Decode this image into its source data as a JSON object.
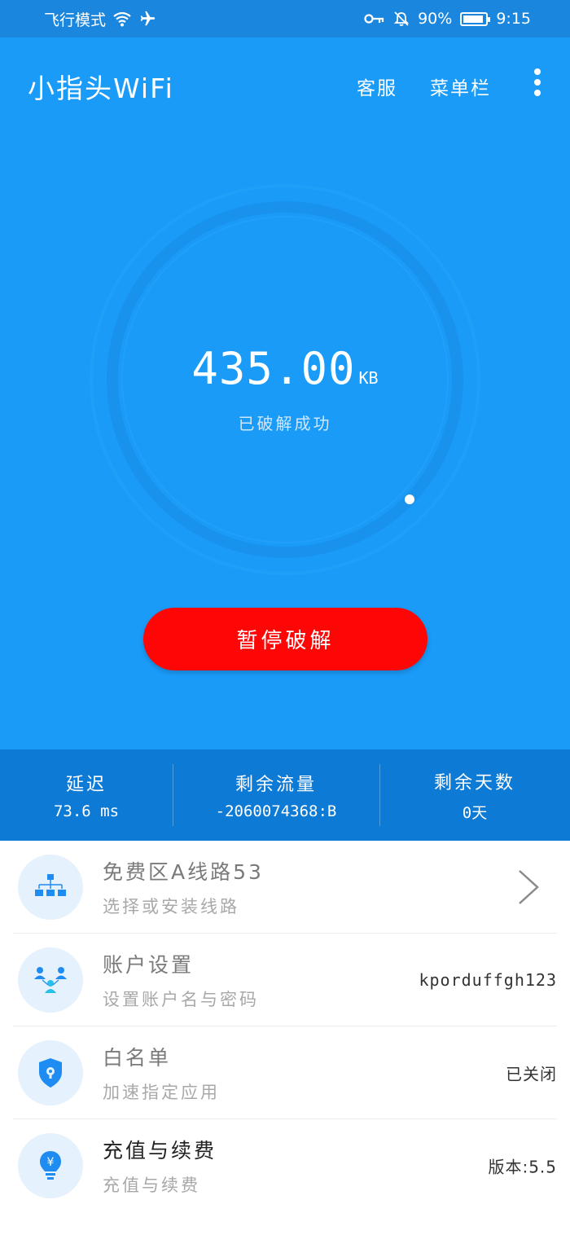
{
  "status_bar": {
    "airplane_mode_label": "飞行模式",
    "battery": "90%",
    "time": "9:15"
  },
  "header": {
    "title": "小指头WiFi",
    "service_label": "客服",
    "menu_label": "菜单栏"
  },
  "gauge": {
    "value": "435.00",
    "unit": "KB",
    "status": "已破解成功"
  },
  "pause_button_label": "暂停破解",
  "stats": [
    {
      "label": "延迟",
      "value": "73.6 ms"
    },
    {
      "label": "剩余流量",
      "value": "-2060074368:B"
    },
    {
      "label": "剩余天数",
      "value": "0天"
    }
  ],
  "list": [
    {
      "title": "免费区A线路53",
      "subtitle": "选择或安装线路",
      "right": ""
    },
    {
      "title": "账户设置",
      "subtitle": "设置账户名与密码",
      "right": "kporduffgh123"
    },
    {
      "title": "白名单",
      "subtitle": "加速指定应用",
      "right": "已关闭"
    },
    {
      "title": "充值与续费",
      "subtitle": "充值与续费",
      "right": "版本:5.5"
    }
  ],
  "colors": {
    "hero_blue": "#1a9bf8",
    "status_blue": "#1a86dd",
    "stats_blue": "#0d7ad6",
    "pause_red": "#ff0606",
    "icon_blue": "#1e8cf0"
  }
}
